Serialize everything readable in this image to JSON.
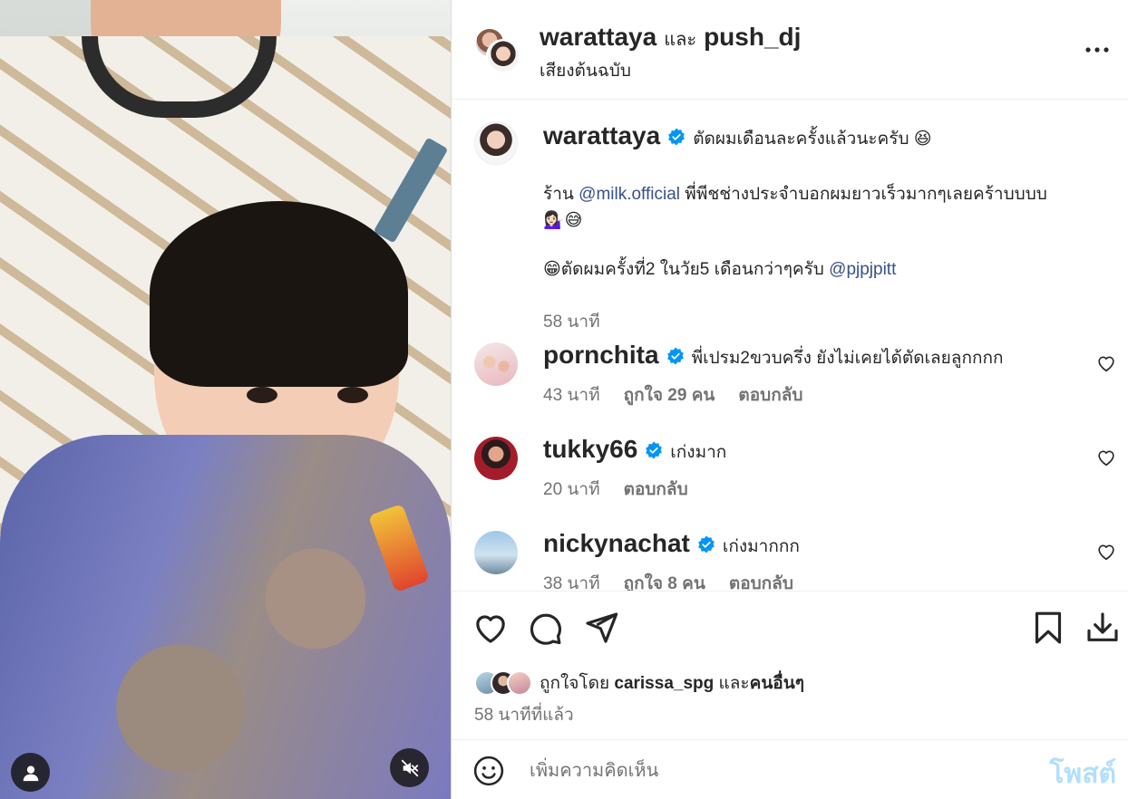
{
  "header": {
    "owner": "warattaya",
    "conjunction": "และ",
    "collaborator": "push_dj",
    "audio": "เสียงต้นฉบับ"
  },
  "caption": {
    "username": "warattaya",
    "line1": "ตัดผมเดือนละครั้งแล้วนะครับ 😆",
    "line2_prefix": "ร้าน ",
    "line2_mention": "@milk.official",
    "line2_suffix": " พี่พีชช่างประจำบอกผมยาวเร็วมากๆเลยคร้าบบบบ",
    "line3": "💁🏻‍♀️😅",
    "line4_prefix": "😁ตัดผมครั้งที่2 ในวัย5 เดือนกว่าๆครับ ",
    "line4_mention": "@pjpjpitt",
    "time": "58 นาที"
  },
  "comments": [
    {
      "username": "pornchita",
      "text": "พี่เปรม2ขวบครึ่ง ยังไม่เคยได้ตัดเลยลูกกกก",
      "time": "43 นาที",
      "likes": "ถูกใจ 29 คน",
      "reply": "ตอบกลับ"
    },
    {
      "username": "tukky66",
      "text": "เก่งมาก",
      "time": "20 นาที",
      "reply": "ตอบกลับ"
    },
    {
      "username": "nickynachat",
      "text": "เก่งมากกก",
      "time": "38 นาที",
      "likes": "ถูกใจ 8 คน",
      "reply": "ตอบกลับ"
    }
  ],
  "likes_summary": {
    "prefix": "ถูกใจโดย ",
    "user": "carissa_spg",
    "middle": " และ",
    "others": "คนอื่นๆ"
  },
  "post_time": "58 นาทีที่แล้ว",
  "composer": {
    "placeholder": "เพิ่มความคิดเห็น",
    "post_label": "โพสต์"
  },
  "icons": {
    "more": "more-options-icon",
    "like": "heart-icon",
    "comment": "comment-bubble-icon",
    "share": "paper-plane-icon",
    "save": "bookmark-icon",
    "download": "download-icon",
    "emoji": "emoji-smile-icon",
    "user": "user-tags-icon",
    "mute": "speaker-muted-icon",
    "verified": "verified-badge-icon"
  },
  "colors": {
    "verified": "#0095f6",
    "mention": "#385185",
    "secondary_text": "#737373",
    "post_button_disabled": "#b2dffc"
  }
}
